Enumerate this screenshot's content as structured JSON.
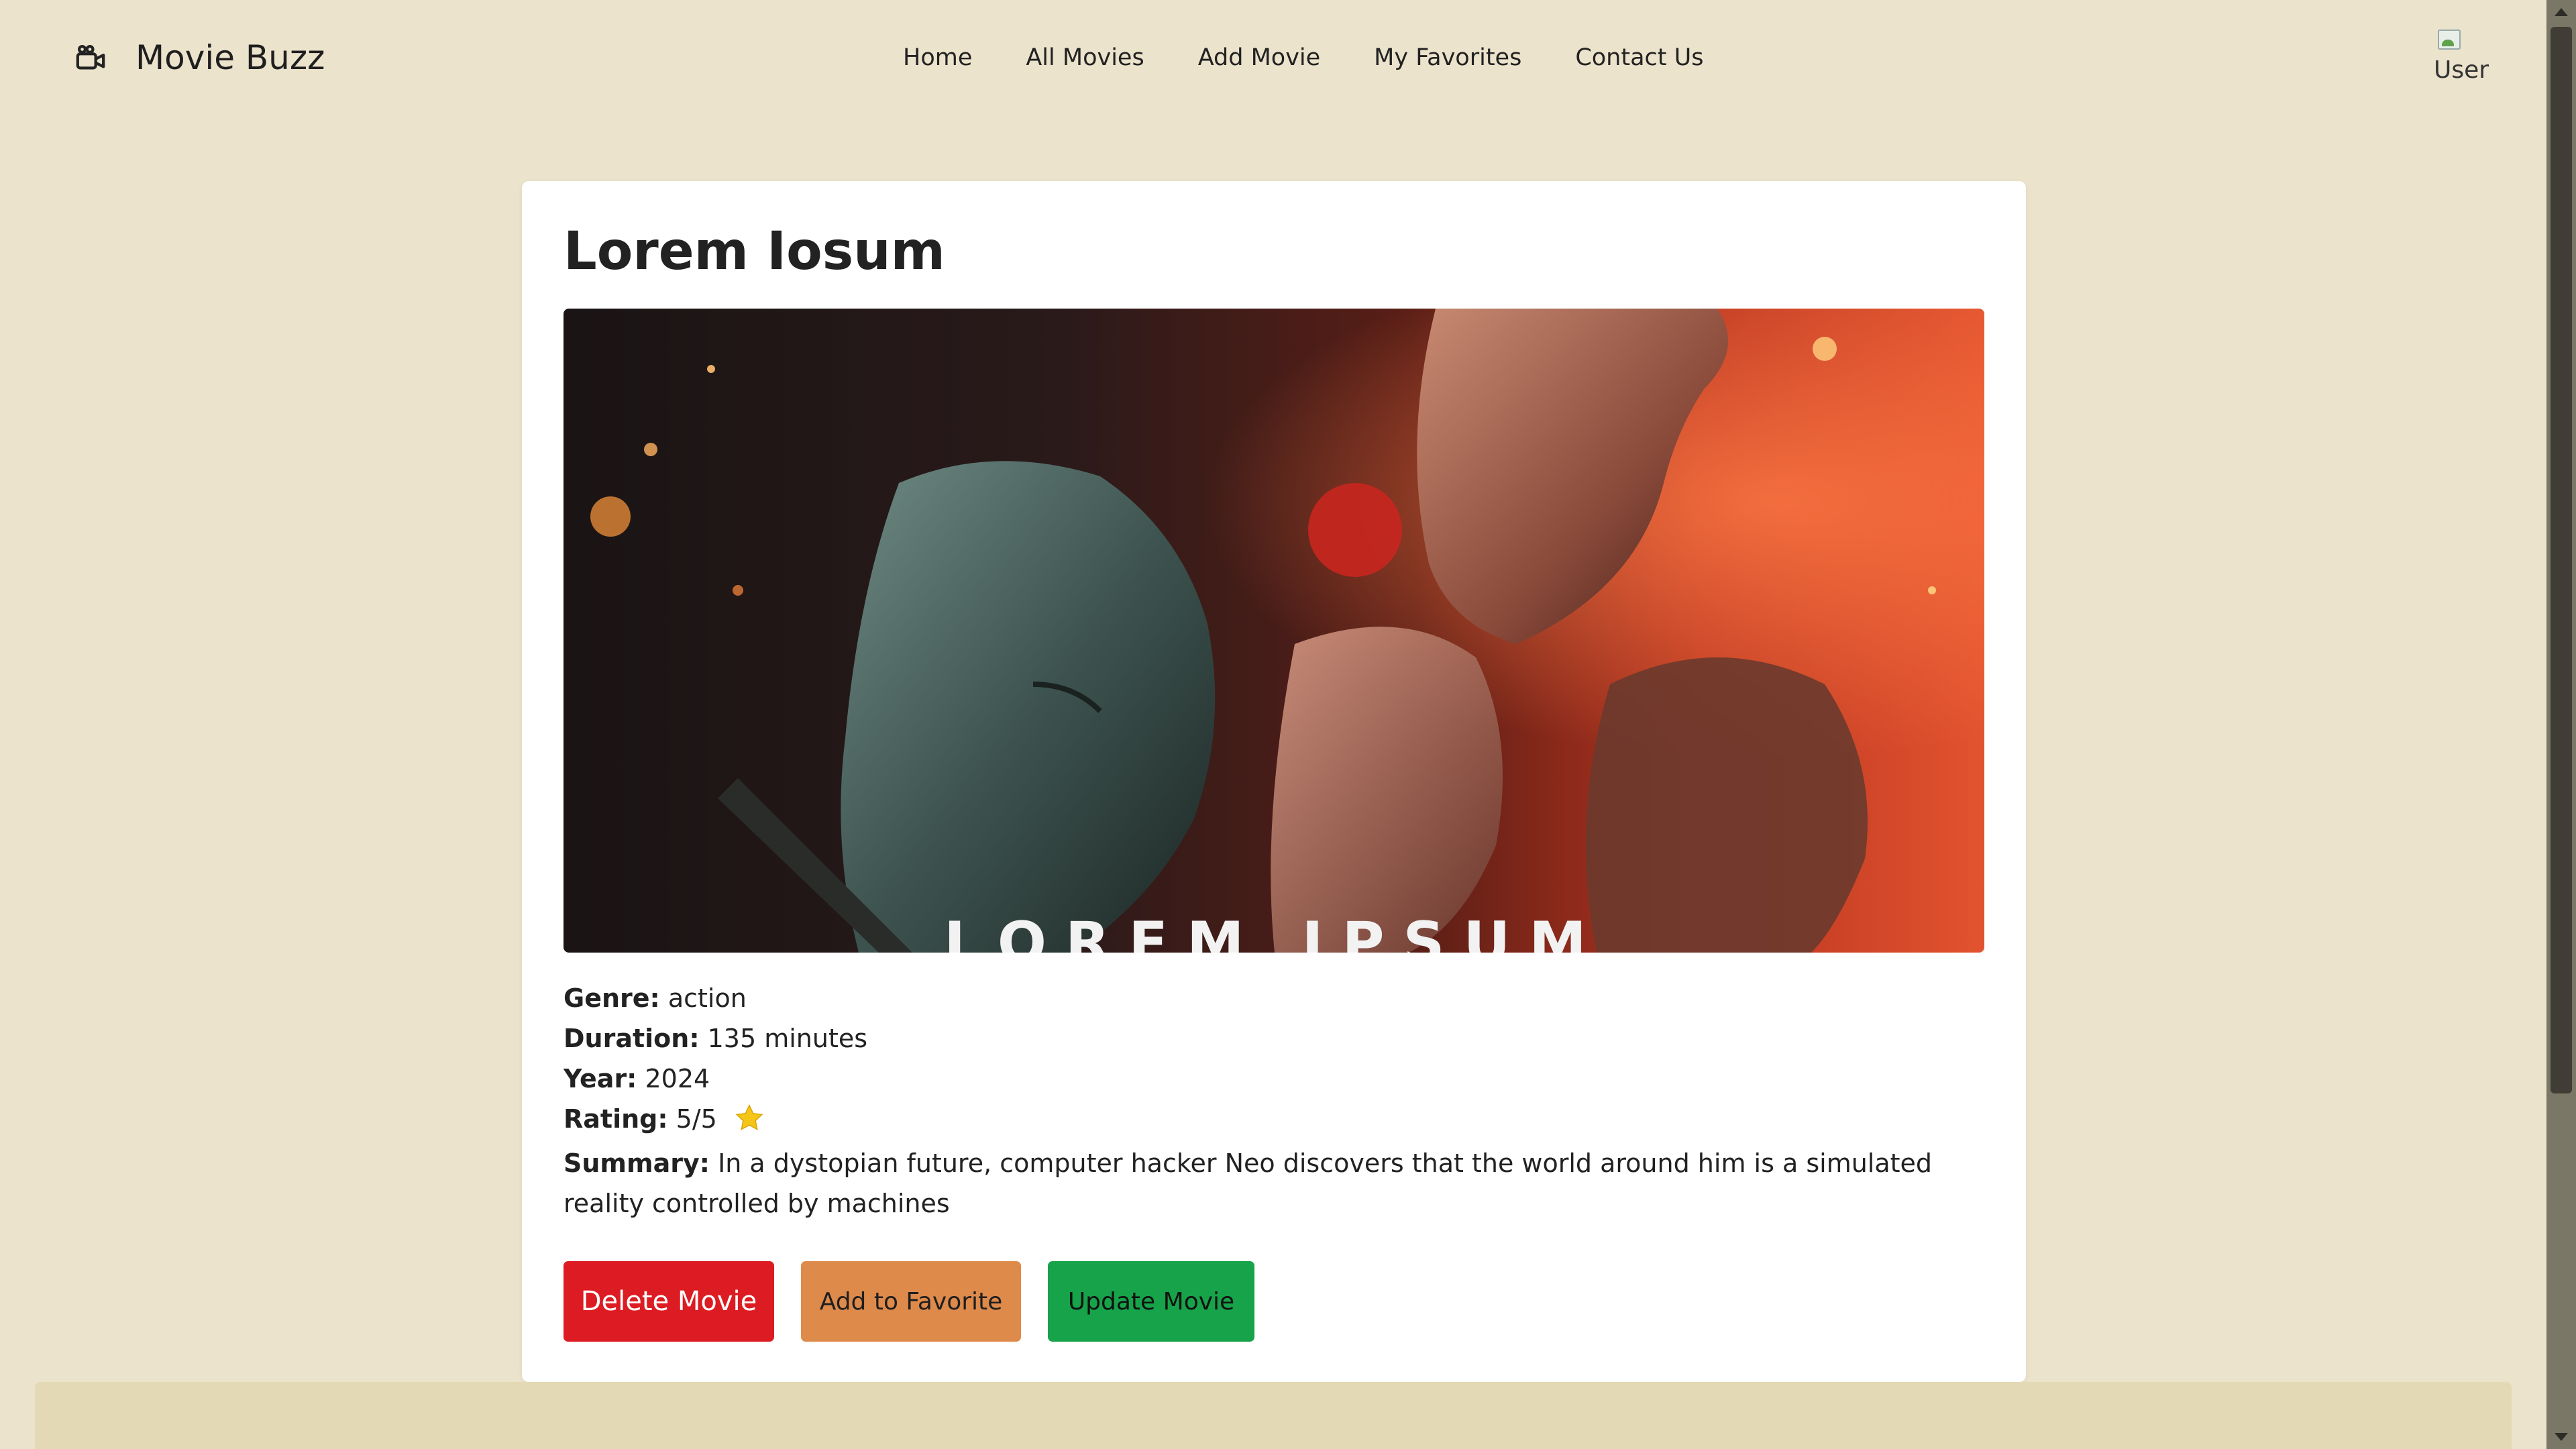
{
  "navbar": {
    "brand": "Movie Buzz",
    "brand_icon": "movie-camera-icon",
    "links": [
      "Home",
      "All Movies",
      "Add Movie",
      "My Favorites",
      "Contact Us"
    ],
    "avatar_alt": "User"
  },
  "movie": {
    "title": "Lorem Iosum",
    "poster_text": "LOREM IPSUM",
    "genre_label": "Genre:",
    "genre": "action",
    "duration_label": "Duration:",
    "duration": "135 minutes",
    "year_label": "Year:",
    "year": "2024",
    "rating_label": "Rating:",
    "rating": "5/5",
    "rating_icon": "star-icon",
    "summary_label": "Summary:",
    "summary": "In a dystopian future, computer hacker Neo discovers that the world around him is a simulated reality controlled by machines"
  },
  "actions": {
    "delete": "Delete Movie",
    "favorite": "Add to Favorite",
    "update": "Update Movie"
  },
  "colors": {
    "background": "#ece3cc",
    "delete": "#dc1c22",
    "favorite": "#de8a4b",
    "update": "#16a34a",
    "star": "#f5c518"
  }
}
